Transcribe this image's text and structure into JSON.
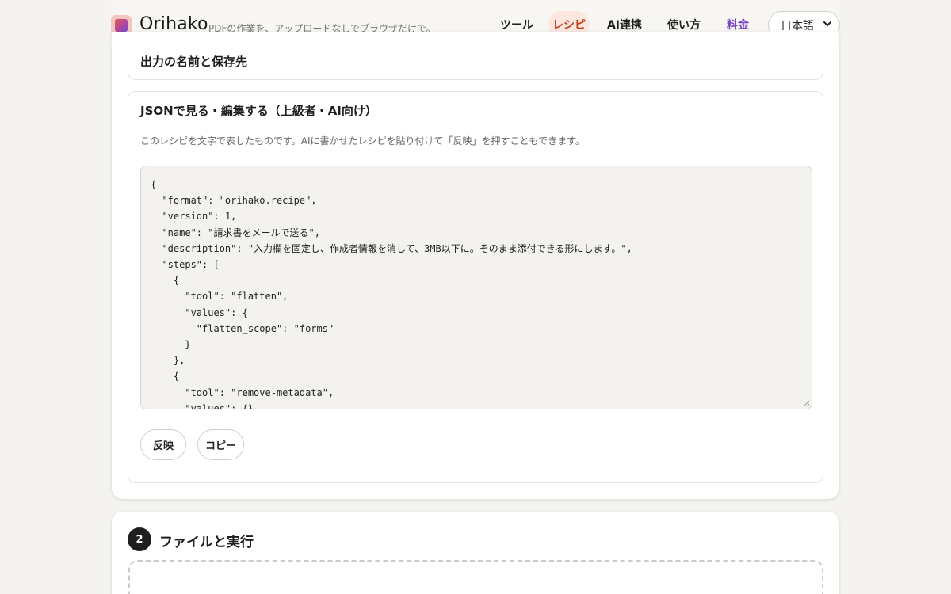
{
  "header": {
    "brand": "Orihako",
    "tagline": "PDFの作業を、アップロードなしでブラウザだけで。",
    "nav": {
      "tools": "ツール",
      "recipe": "レシピ",
      "ai": "AI連携",
      "howto": "使い方",
      "pricing": "料金"
    },
    "language": "日本語",
    "active_nav": "recipe"
  },
  "section_output": {
    "title": "出力の名前と保存先"
  },
  "section_json": {
    "title": "JSONで見る・編集する（上級者・AI向け）",
    "description": "このレシピを文字で表したものです。AIに書かせたレシピを貼り付けて「反映」を押すこともできます。",
    "json_text": "{\n  \"format\": \"orihako.recipe\",\n  \"version\": 1,\n  \"name\": \"請求書をメールで送る\",\n  \"description\": \"入力欄を固定し、作成者情報を消して、3MB以下に。そのまま添付できる形にします。\",\n  \"steps\": [\n    {\n      \"tool\": \"flatten\",\n      \"values\": {\n        \"flatten_scope\": \"forms\"\n      }\n    },\n    {\n      \"tool\": \"remove-metadata\",\n      \"values\": {}",
    "apply_label": "反映",
    "copy_label": "コピー"
  },
  "step2": {
    "number": "2",
    "title": "ファイルと実行"
  },
  "colors": {
    "accent": "#c94a24",
    "pricing": "#7345c9",
    "background": "#f4f3f0"
  }
}
